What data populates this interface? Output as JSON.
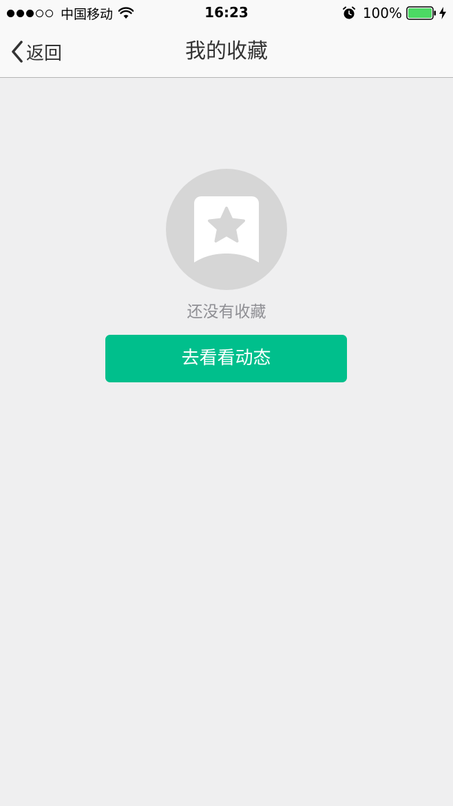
{
  "status_bar": {
    "carrier": "中国移动",
    "time": "16:23",
    "battery_percent": "100%",
    "signal_bars_filled": 3,
    "signal_bars_total": 5,
    "icons": [
      "wifi-icon",
      "alarm-icon",
      "battery-icon",
      "bolt-icon"
    ],
    "battery_color": "#4cd964"
  },
  "nav": {
    "back_label": "返回",
    "title": "我的收藏",
    "back_icon": "chevron-left-icon"
  },
  "empty_state": {
    "icon": "bookmark-star-icon",
    "message": "还没有收藏",
    "button_label": "去看看动态"
  },
  "colors": {
    "accent": "#00bf8c",
    "background": "#efeff0",
    "illustration_circle": "#d6d6d6",
    "secondary_text": "#8f8f94"
  }
}
